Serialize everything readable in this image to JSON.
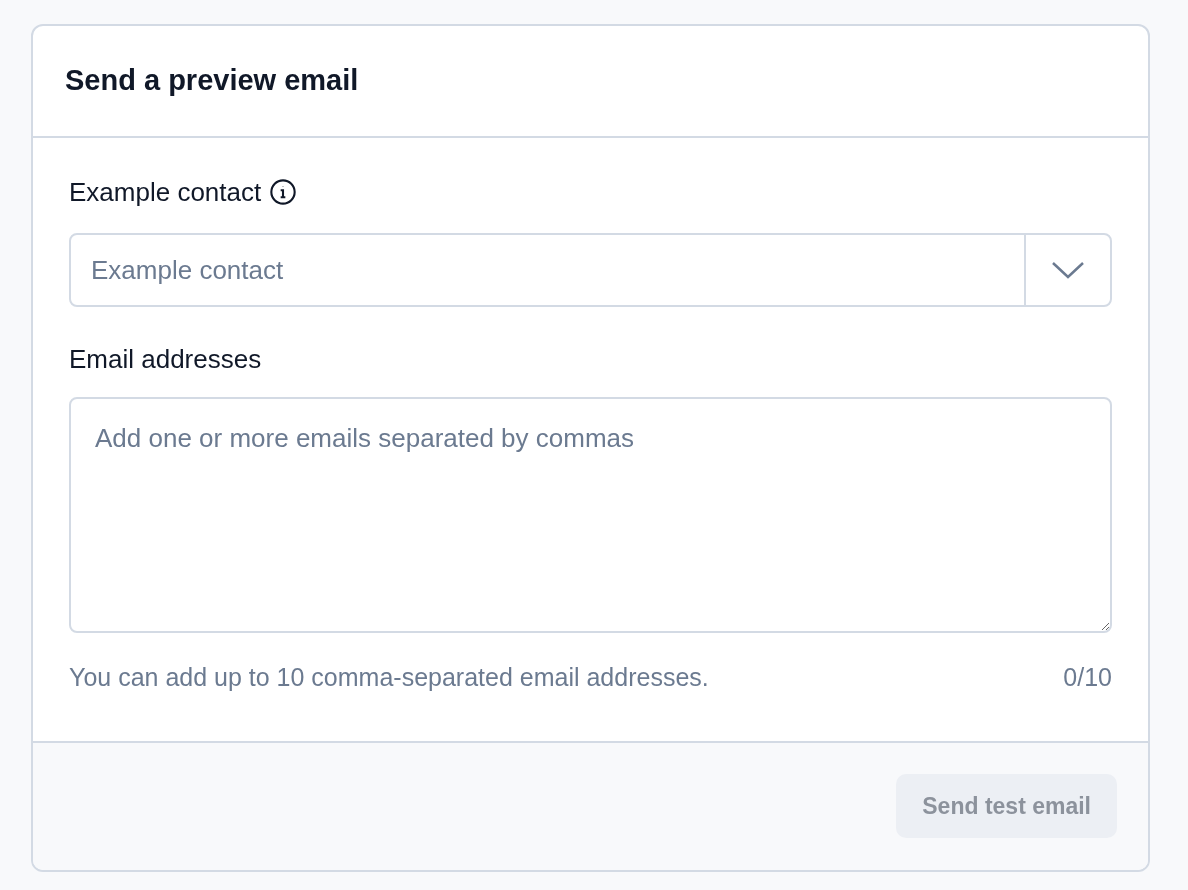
{
  "dialog": {
    "title": "Send a preview email"
  },
  "contact_field": {
    "label": "Example contact",
    "placeholder": "Example contact"
  },
  "emails_field": {
    "label": "Email addresses",
    "placeholder": "Add one or more emails separated by commas",
    "hint": "You can add up to 10 comma-separated email addresses.",
    "count": "0/10"
  },
  "send_button": {
    "label": "Send test email",
    "disabled": true
  }
}
